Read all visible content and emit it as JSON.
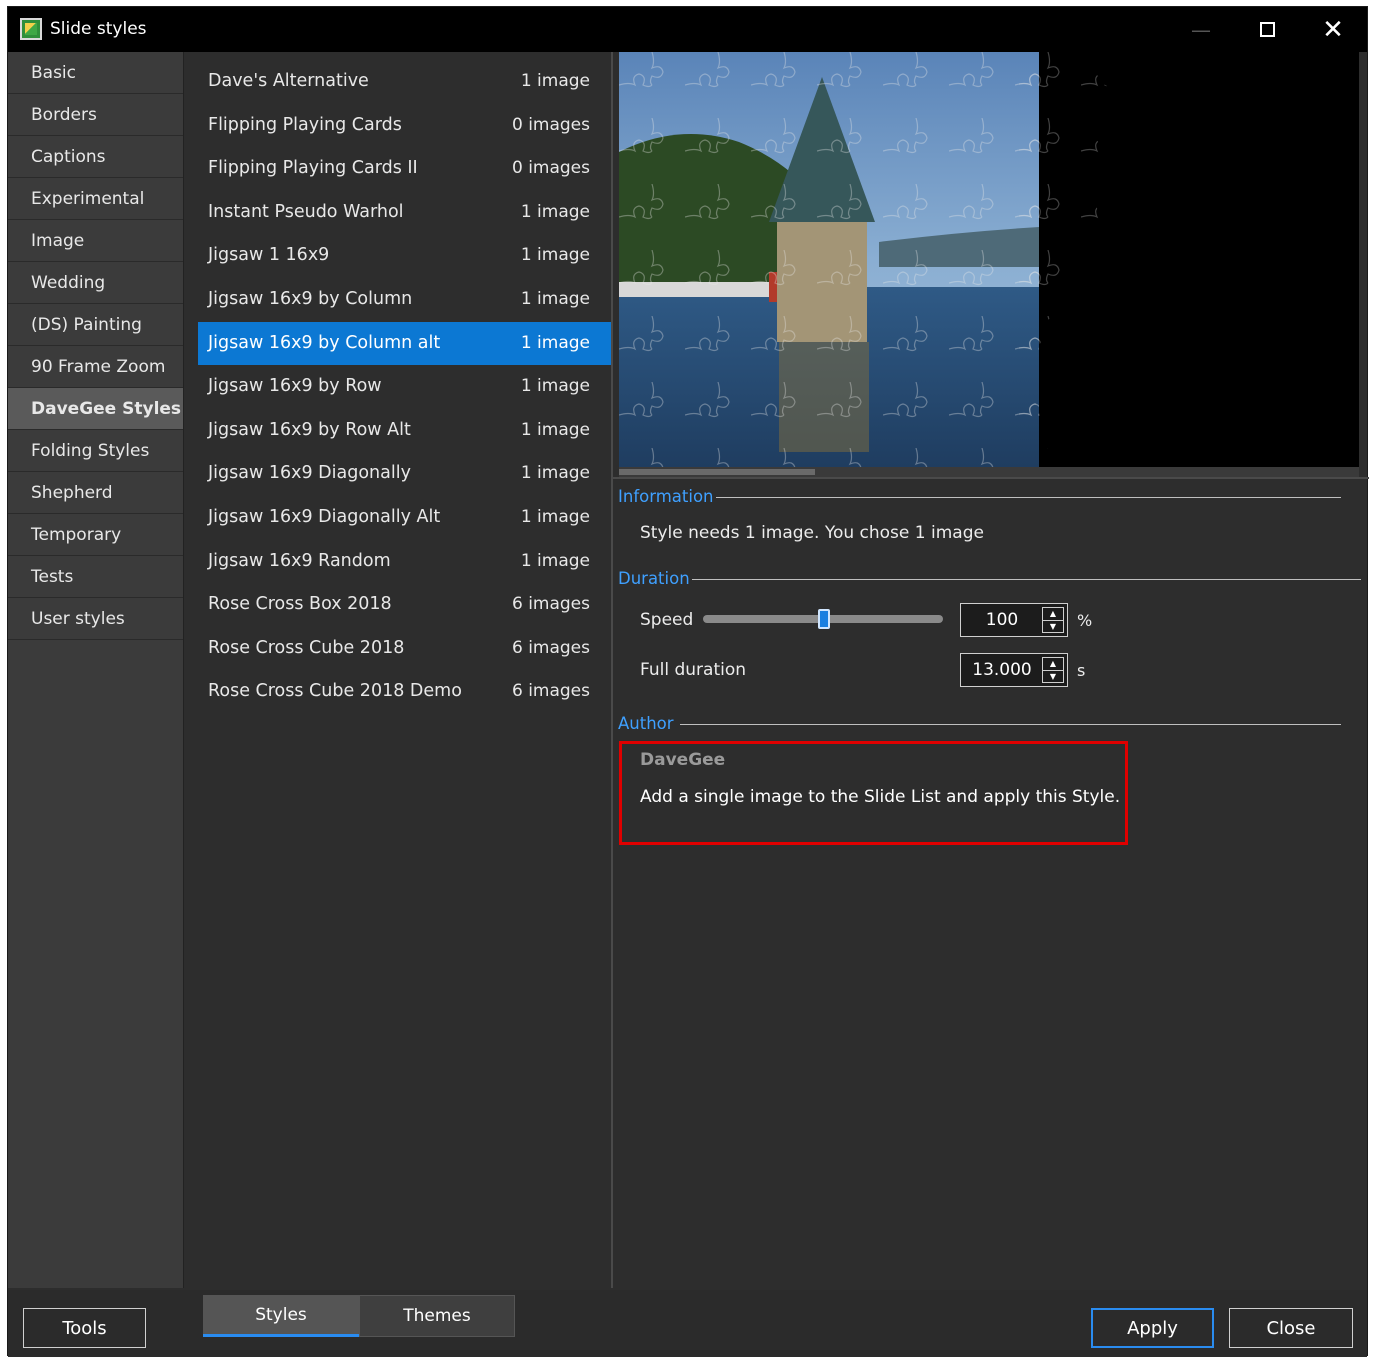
{
  "window": {
    "title": "Slide styles"
  },
  "categories": [
    {
      "label": "Basic",
      "selected": false
    },
    {
      "label": "Borders",
      "selected": false
    },
    {
      "label": "Captions",
      "selected": false
    },
    {
      "label": "Experimental",
      "selected": false
    },
    {
      "label": "Image",
      "selected": false
    },
    {
      "label": "Wedding",
      "selected": false
    },
    {
      "label": "(DS) Painting",
      "selected": false
    },
    {
      "label": "90 Frame Zoom",
      "selected": false
    },
    {
      "label": "DaveGee Styles",
      "selected": true
    },
    {
      "label": "Folding Styles",
      "selected": false
    },
    {
      "label": "Shepherd",
      "selected": false
    },
    {
      "label": "Temporary",
      "selected": false
    },
    {
      "label": "Tests",
      "selected": false
    },
    {
      "label": "User styles",
      "selected": false
    }
  ],
  "styles": [
    {
      "name": "Dave's Alternative",
      "count": "1 image",
      "selected": false
    },
    {
      "name": "Flipping Playing Cards",
      "count": "0 images",
      "selected": false
    },
    {
      "name": "Flipping Playing Cards II",
      "count": "0 images",
      "selected": false
    },
    {
      "name": "Instant Pseudo Warhol",
      "count": "1 image",
      "selected": false
    },
    {
      "name": "Jigsaw 1 16x9",
      "count": "1 image",
      "selected": false
    },
    {
      "name": "Jigsaw 16x9 by Column",
      "count": "1 image",
      "selected": false
    },
    {
      "name": "Jigsaw 16x9 by Column alt",
      "count": "1 image",
      "selected": true
    },
    {
      "name": "Jigsaw 16x9 by Row",
      "count": "1 image",
      "selected": false
    },
    {
      "name": "Jigsaw 16x9 by Row Alt",
      "count": "1 image",
      "selected": false
    },
    {
      "name": "Jigsaw 16x9 Diagonally",
      "count": "1 image",
      "selected": false
    },
    {
      "name": "Jigsaw 16x9 Diagonally Alt",
      "count": "1 image",
      "selected": false
    },
    {
      "name": "Jigsaw 16x9 Random",
      "count": "1 image",
      "selected": false
    },
    {
      "name": "Rose Cross Box 2018",
      "count": "6 images",
      "selected": false
    },
    {
      "name": "Rose Cross Cube 2018",
      "count": "6 images",
      "selected": false
    },
    {
      "name": "Rose Cross Cube 2018 Demo",
      "count": "6 images",
      "selected": false
    }
  ],
  "information": {
    "legend": "Information",
    "text": "Style needs 1 image. You chose 1 image"
  },
  "duration": {
    "legend": "Duration",
    "speed_label": "Speed",
    "speed_value": "100",
    "speed_unit": "%",
    "speed_slider_fraction": 0.5,
    "full_label": "Full duration",
    "full_value": "13.000",
    "full_unit": "s"
  },
  "author": {
    "legend": "Author",
    "name": "DaveGee",
    "description": "Add a single image to the Slide List and apply this Style."
  },
  "bottom": {
    "tools": "Tools",
    "tab_styles": "Styles",
    "tab_themes": "Themes",
    "apply": "Apply",
    "close": "Close"
  },
  "colors": {
    "accent": "#0c78d3",
    "legend": "#3fa0ff",
    "highlight": "#e00000"
  }
}
